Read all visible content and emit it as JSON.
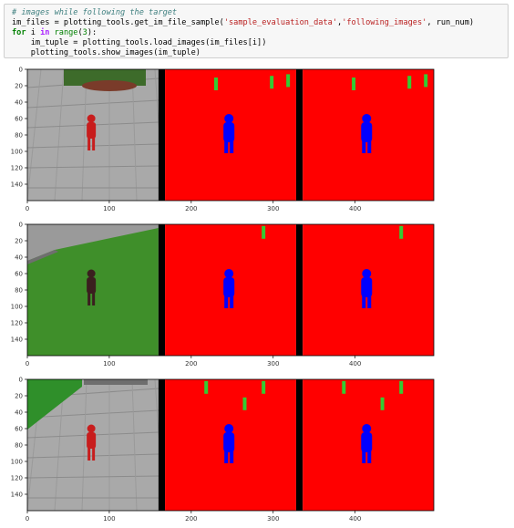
{
  "notebook": {
    "code_lines": [
      {
        "parts": [
          {
            "t": "# images while following the target",
            "c": "c-comment"
          }
        ]
      },
      {
        "parts": [
          {
            "t": "im_files = plotting_tools.get_im_file_sample(",
            "c": ""
          },
          {
            "t": "'sample_evaluation_data'",
            "c": "c-str"
          },
          {
            "t": ",",
            "c": ""
          },
          {
            "t": "'following_images'",
            "c": "c-str"
          },
          {
            "t": ", run_num)",
            "c": ""
          }
        ]
      },
      {
        "parts": [
          {
            "t": "for",
            "c": "c-kw"
          },
          {
            "t": " i ",
            "c": ""
          },
          {
            "t": "in",
            "c": "c-op"
          },
          {
            "t": " ",
            "c": ""
          },
          {
            "t": "range",
            "c": "c-builtin"
          },
          {
            "t": "(",
            "c": ""
          },
          {
            "t": "3",
            "c": "c-num"
          },
          {
            "t": "):",
            "c": ""
          }
        ]
      },
      {
        "parts": [
          {
            "t": "    im_tuple = plotting_tools.load_images(im_files[i])",
            "c": ""
          }
        ]
      },
      {
        "parts": [
          {
            "t": "    plotting_tools.show_images(im_tuple)",
            "c": ""
          }
        ]
      }
    ]
  },
  "plots": {
    "y_ticks": [
      "0",
      "20",
      "40",
      "60",
      "80",
      "100",
      "120",
      "140"
    ],
    "x_ticks": [
      "0",
      "100",
      "200",
      "300",
      "400"
    ],
    "colors": {
      "mask_bg": "#ff0000",
      "target": "#0000ff",
      "people": "#33cc33",
      "separator": "#000000"
    }
  }
}
